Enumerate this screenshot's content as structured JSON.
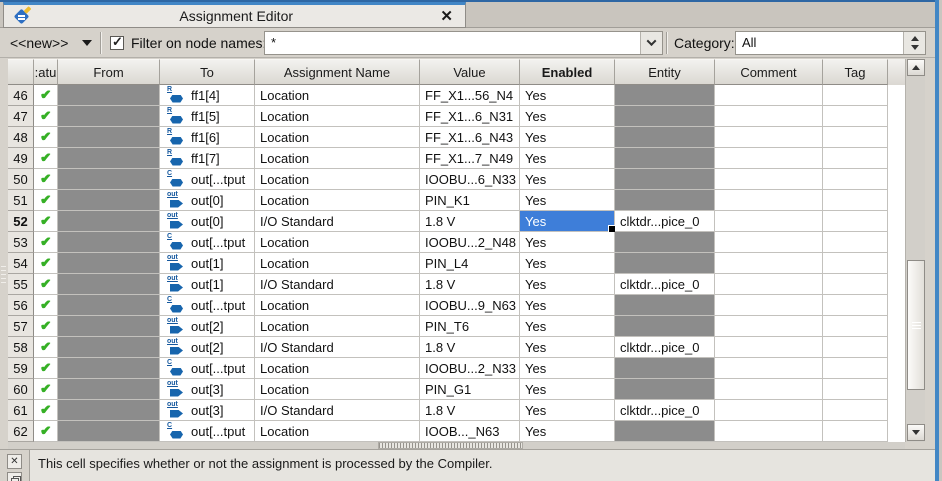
{
  "tab": {
    "title": "Assignment Editor",
    "close_glyph": "✕"
  },
  "toolbar": {
    "new_selector": "<<new>>",
    "filter_checkbox_checked": true,
    "filter_check_glyph": "✓",
    "filter_label": "Filter on node names:",
    "filter_value": "*",
    "category_label": "Category:",
    "category_value": "All"
  },
  "colors": {
    "accent_blue": "#4186c6",
    "selection_blue": "#3e7ed9",
    "check_green": "#36b026",
    "disabled_gray": "#8c8c8c"
  },
  "table": {
    "headers": {
      "corner": "",
      "status": ":atu",
      "from": "From",
      "to": "To",
      "name": "Assignment Name",
      "value": "Value",
      "enabled": "Enabled",
      "entity": "Entity",
      "comment": "Comment",
      "tag": "Tag"
    },
    "status_glyph": "✔",
    "rows": [
      {
        "num": "46",
        "icon": "register",
        "to": "ff1[4]",
        "name": "Location",
        "value": "FF_X1...56_N4",
        "enabled": "Yes",
        "entity": null
      },
      {
        "num": "47",
        "icon": "register",
        "to": "ff1[5]",
        "name": "Location",
        "value": "FF_X1...6_N31",
        "enabled": "Yes",
        "entity": null
      },
      {
        "num": "48",
        "icon": "register",
        "to": "ff1[6]",
        "name": "Location",
        "value": "FF_X1...6_N43",
        "enabled": "Yes",
        "entity": null
      },
      {
        "num": "49",
        "icon": "register",
        "to": "ff1[7]",
        "name": "Location",
        "value": "FF_X1...7_N49",
        "enabled": "Yes",
        "entity": null
      },
      {
        "num": "50",
        "icon": "comb",
        "to": "out[...tput",
        "name": "Location",
        "value": "IOOBU...6_N33",
        "enabled": "Yes",
        "entity": null
      },
      {
        "num": "51",
        "icon": "output",
        "to": "out[0]",
        "name": "Location",
        "value": "PIN_K1",
        "enabled": "Yes",
        "entity": null
      },
      {
        "num": "52",
        "icon": "output",
        "to": "out[0]",
        "name": "I/O Standard",
        "value": "1.8 V",
        "enabled": "Yes",
        "entity": "clktdr...pice_0",
        "selected": true
      },
      {
        "num": "53",
        "icon": "comb",
        "to": "out[...tput",
        "name": "Location",
        "value": "IOOBU...2_N48",
        "enabled": "Yes",
        "entity": null
      },
      {
        "num": "54",
        "icon": "output",
        "to": "out[1]",
        "name": "Location",
        "value": "PIN_L4",
        "enabled": "Yes",
        "entity": null
      },
      {
        "num": "55",
        "icon": "output",
        "to": "out[1]",
        "name": "I/O Standard",
        "value": "1.8 V",
        "enabled": "Yes",
        "entity": "clktdr...pice_0"
      },
      {
        "num": "56",
        "icon": "comb",
        "to": "out[...tput",
        "name": "Location",
        "value": "IOOBU...9_N63",
        "enabled": "Yes",
        "entity": null
      },
      {
        "num": "57",
        "icon": "output",
        "to": "out[2]",
        "name": "Location",
        "value": "PIN_T6",
        "enabled": "Yes",
        "entity": null
      },
      {
        "num": "58",
        "icon": "output",
        "to": "out[2]",
        "name": "I/O Standard",
        "value": "1.8 V",
        "enabled": "Yes",
        "entity": "clktdr...pice_0"
      },
      {
        "num": "59",
        "icon": "comb",
        "to": "out[...tput",
        "name": "Location",
        "value": "IOOBU...2_N33",
        "enabled": "Yes",
        "entity": null
      },
      {
        "num": "60",
        "icon": "output",
        "to": "out[3]",
        "name": "Location",
        "value": "PIN_G1",
        "enabled": "Yes",
        "entity": null
      },
      {
        "num": "61",
        "icon": "output",
        "to": "out[3]",
        "name": "I/O Standard",
        "value": "1.8 V",
        "enabled": "Yes",
        "entity": "clktdr...pice_0"
      },
      {
        "num": "62",
        "icon": "comb",
        "to": "out[...tput",
        "name": "Location",
        "value": "IOOB..._N63",
        "enabled": "Yes",
        "entity": null
      }
    ]
  },
  "statusbar": {
    "message": "This cell specifies whether or not the assignment is processed by the Compiler."
  }
}
